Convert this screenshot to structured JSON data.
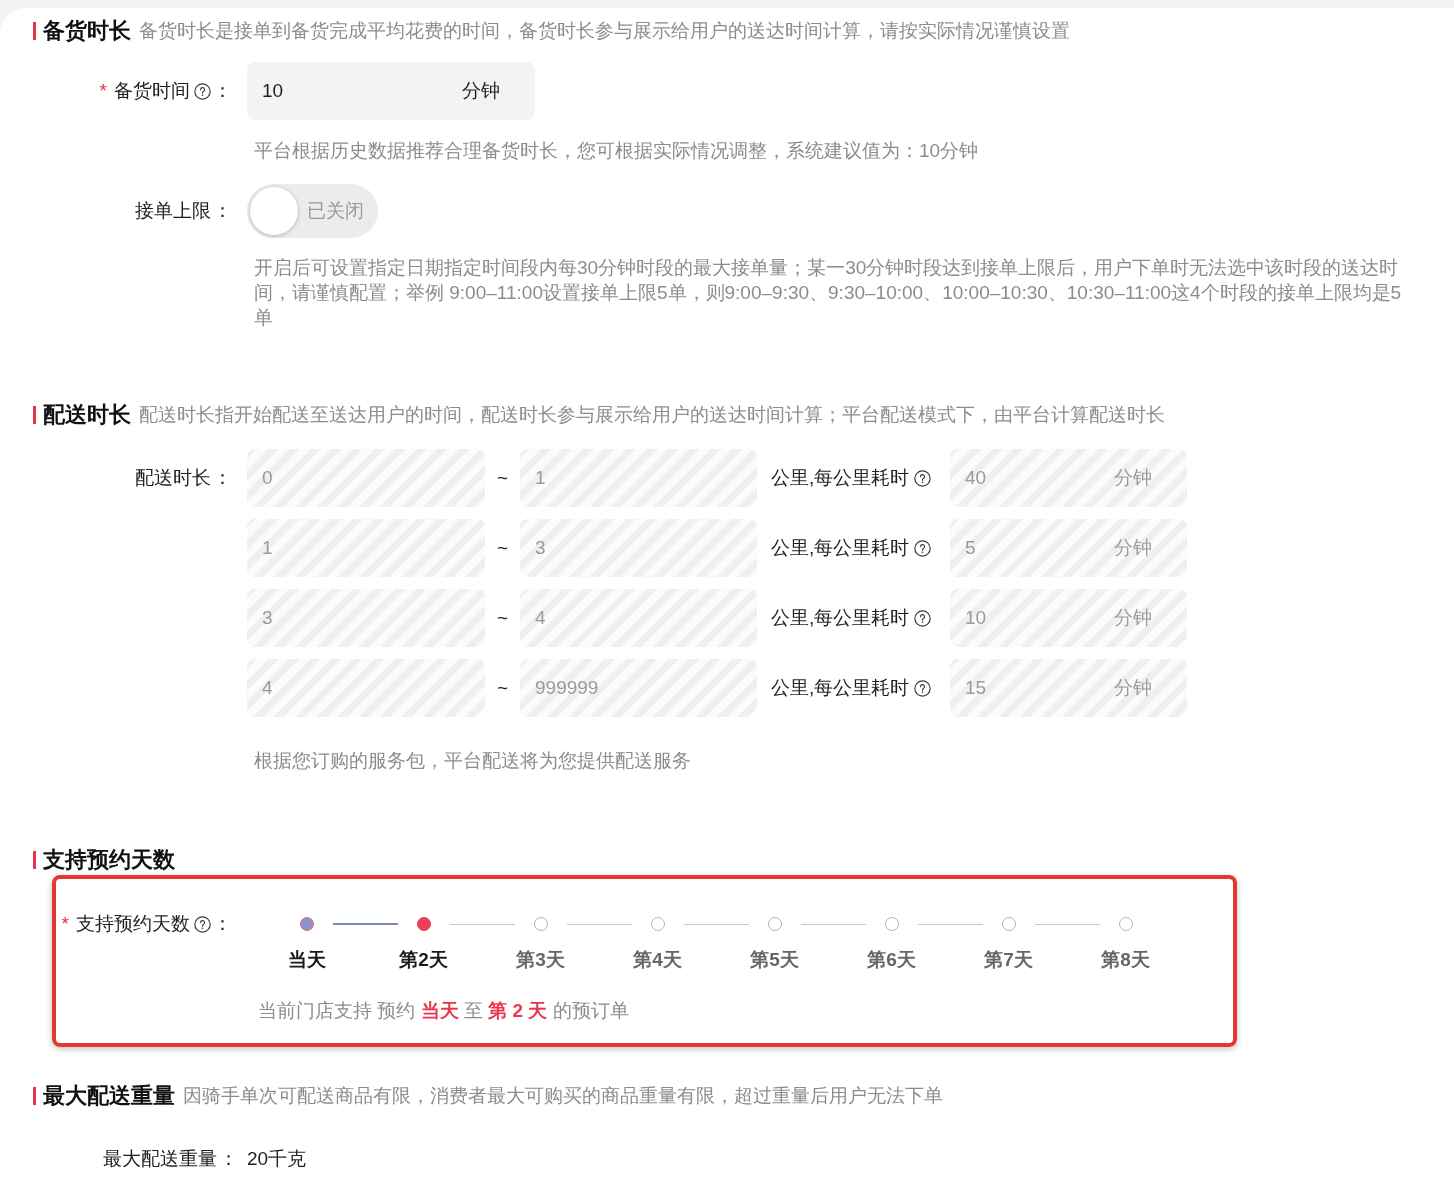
{
  "prep_section": {
    "title": "备货时长",
    "description": "备货时长是接单到备货完成平均花费的时间，备货时长参与展示给用户的送达时间计算，请按实际情况谨慎设置",
    "prep_time": {
      "label": {
        "required_mark": "*",
        "text": "备货时间",
        "help": true,
        "colon": "："
      },
      "value": "10",
      "unit": "分钟",
      "disabled": false,
      "hint": "平台根据历史数据推荐合理备货时长，您可根据实际情况调整，系统建议值为：10分钟"
    },
    "order_limit": {
      "label": {
        "text": "接单上限",
        "colon": "："
      },
      "on": false,
      "state_text": "已关闭",
      "hint": "开启后可设置指定日期指定时间段内每30分钟时段的最大接单量；某一30分钟时段达到接单上限后，用户下单时无法选中该时段的送达时间，请谨慎配置；举例 9:00–11:00设置接单上限5单，则9:00–9:30、9:30–10:00、10:00–10:30、10:30–11:00这4个时段的接单上限均是5单"
    }
  },
  "delivery_section": {
    "title": "配送时长",
    "description": "配送时长指开始配送至送达用户的时间，配送时长参与展示给用户的送达时间计算；平台配送模式下，由平台计算配送时长",
    "label": {
      "text": "配送时长",
      "colon": "："
    },
    "rows": [
      {
        "from": "0",
        "separator": "~",
        "to": "1",
        "per_km_label": "公里,每公里耗时",
        "per_km_help": true,
        "minutes": "40",
        "unit": "分钟",
        "disabled": true
      },
      {
        "from": "1",
        "separator": "~",
        "to": "3",
        "per_km_label": "公里,每公里耗时",
        "per_km_help": true,
        "minutes": "5",
        "unit": "分钟",
        "disabled": true
      },
      {
        "from": "3",
        "separator": "~",
        "to": "4",
        "per_km_label": "公里,每公里耗时",
        "per_km_help": true,
        "minutes": "10",
        "unit": "分钟",
        "disabled": true
      },
      {
        "from": "4",
        "separator": "~",
        "to": "999999",
        "per_km_label": "公里,每公里耗时",
        "per_km_help": true,
        "minutes": "15",
        "unit": "分钟",
        "disabled": true
      }
    ],
    "hint": "根据您订购的服务包，平台配送将为您提供配送服务"
  },
  "reservation_section": {
    "title": "支持预约天数",
    "highlighted": true,
    "label": {
      "required_mark": "*",
      "text": "支持预约天数",
      "help": true,
      "colon": "："
    },
    "days": [
      {
        "label": "当天",
        "in_range": true,
        "selected": false
      },
      {
        "label": "第2天",
        "in_range": true,
        "selected": true
      },
      {
        "label": "第3天",
        "in_range": false,
        "selected": false
      },
      {
        "label": "第4天",
        "in_range": false,
        "selected": false
      },
      {
        "label": "第5天",
        "in_range": false,
        "selected": false
      },
      {
        "label": "第6天",
        "in_range": false,
        "selected": false
      },
      {
        "label": "第7天",
        "in_range": false,
        "selected": false
      },
      {
        "label": "第8天",
        "in_range": false,
        "selected": false
      }
    ],
    "summary": [
      {
        "text": "当前门店支持 预约 ",
        "highlight": false
      },
      {
        "text": "当天",
        "highlight": true
      },
      {
        "text": " 至 ",
        "highlight": false
      },
      {
        "text": "第 2 天",
        "highlight": true
      },
      {
        "text": " 的预订单",
        "highlight": false
      }
    ]
  },
  "weight_section": {
    "title": "最大配送重量",
    "description": "因骑手单次可配送商品有限，消费者最大可购买的商品重量有限，超过重量后用户无法下单",
    "label": {
      "text": "最大配送重量",
      "colon": "："
    },
    "value": "20千克"
  }
}
